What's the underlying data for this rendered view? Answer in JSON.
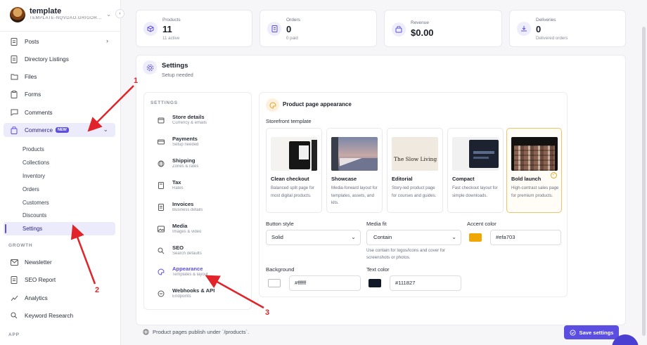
{
  "org": {
    "name": "template",
    "subtitle": "TEMPLATE-NQVDAO.GRIGOR..."
  },
  "sidebar": {
    "items": [
      {
        "label": "Posts"
      },
      {
        "label": "Directory Listings"
      },
      {
        "label": "Files"
      },
      {
        "label": "Forms"
      },
      {
        "label": "Comments"
      },
      {
        "label": "Commerce",
        "badge": "NEW"
      }
    ],
    "commerce_sub": [
      "Products",
      "Collections",
      "Inventory",
      "Orders",
      "Customers",
      "Discounts",
      "Settings"
    ],
    "growth_label": "GROWTH",
    "growth_items": [
      "Newsletter",
      "SEO Report",
      "Analytics",
      "Keyword Research"
    ],
    "app_label": "APP"
  },
  "stats": [
    {
      "label": "Products",
      "value": "11",
      "sub": "11 active"
    },
    {
      "label": "Orders",
      "value": "0",
      "sub": "0 paid"
    },
    {
      "label": "Revenue",
      "value": "$0.00",
      "sub": ""
    },
    {
      "label": "Deliveries",
      "value": "0",
      "sub": "Delivered orders"
    }
  ],
  "settings": {
    "title": "Settings",
    "subtitle": "Setup needed"
  },
  "settings_nav": {
    "label": "SETTINGS",
    "items": [
      {
        "title": "Store details",
        "desc": "Currency & emails"
      },
      {
        "title": "Payments",
        "desc": "Setup needed"
      },
      {
        "title": "Shipping",
        "desc": "Zones & rates"
      },
      {
        "title": "Tax",
        "desc": "Rates"
      },
      {
        "title": "Invoices",
        "desc": "Business details"
      },
      {
        "title": "Media",
        "desc": "Images & video"
      },
      {
        "title": "SEO",
        "desc": "Search defaults"
      },
      {
        "title": "Appearance",
        "desc": "Templates & layout"
      },
      {
        "title": "Webhooks & API",
        "desc": "Endpoints"
      }
    ]
  },
  "appearance": {
    "title": "Product page appearance",
    "storefront_label": "Storefront template",
    "templates": [
      {
        "name": "Clean checkout",
        "desc": "Balanced split page for most digital products."
      },
      {
        "name": "Showcase",
        "desc": "Media-forward layout for templates, assets, and kits."
      },
      {
        "name": "Editorial",
        "desc": "Story-led product page for courses and guides.",
        "thumb_text": "The Slow Living Guide"
      },
      {
        "name": "Compact",
        "desc": "Fast checkout layout for simple downloads."
      },
      {
        "name": "Bold launch",
        "desc": "High-contrast sales page for premium products."
      }
    ],
    "button_style_label": "Button style",
    "button_style_value": "Solid",
    "media_fit_label": "Media fit",
    "media_fit_value": "Contain",
    "media_fit_help": "Use contain for logos/icons and cover for screenshots or photos.",
    "accent_label": "Accent color",
    "accent_value": "#efa703",
    "background_label": "Background",
    "background_value": "#ffffff",
    "text_label": "Text color",
    "text_value": "#111827"
  },
  "footer": {
    "note": "Product pages publish under `/products`.",
    "save_label": "Save settings"
  },
  "annotations": [
    "1",
    "2",
    "3"
  ],
  "colors": {
    "accent": "#5b4ee0",
    "highlight": "#efa703",
    "arrow": "#e0242a"
  }
}
